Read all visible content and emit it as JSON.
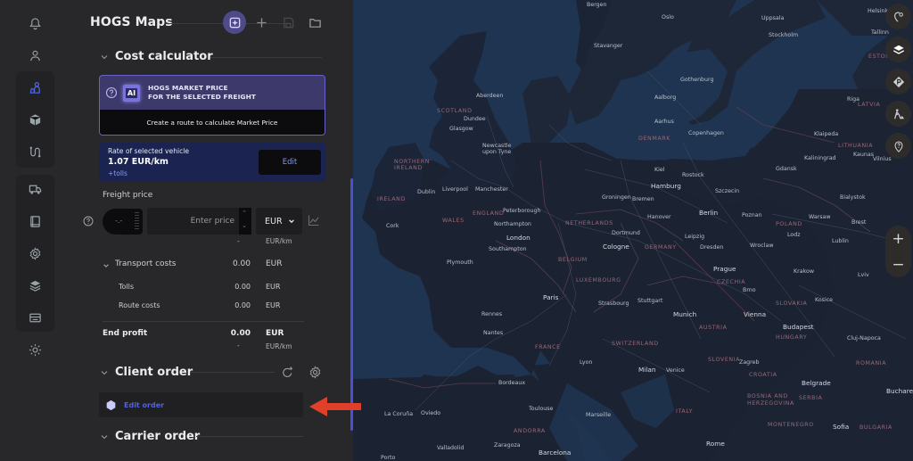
{
  "app": {
    "title": "HOGS Maps"
  },
  "rail": {
    "items": [
      {
        "name": "notifications",
        "icon": "bell-icon"
      },
      {
        "name": "profile",
        "icon": "user-icon"
      },
      {
        "name": "freight",
        "icon": "people-icon",
        "active": true
      },
      {
        "name": "cargo",
        "icon": "box-icon"
      },
      {
        "name": "routes",
        "icon": "route-icon"
      },
      {
        "name": "vehicles",
        "icon": "truck-icon"
      },
      {
        "name": "documents",
        "icon": "book-icon"
      },
      {
        "name": "settings",
        "icon": "gear-icon"
      },
      {
        "name": "layers",
        "icon": "stack-icon"
      },
      {
        "name": "billing",
        "icon": "card-icon"
      },
      {
        "name": "theme",
        "icon": "sun-icon"
      }
    ]
  },
  "header_buttons": [
    {
      "name": "ai-assistant",
      "icon": "sparkle-doc-icon",
      "active": true
    },
    {
      "name": "add",
      "icon": "plus-icon"
    },
    {
      "name": "save",
      "icon": "save-icon",
      "disabled": true
    },
    {
      "name": "open",
      "icon": "folder-icon"
    }
  ],
  "cost_calculator": {
    "title": "Cost calculator",
    "market": {
      "badge": "AI",
      "title_line1": "HOGS MARKET PRICE",
      "title_line2": "FOR THE SELECTED FREIGHT",
      "cta": "Create a route to calculate Market Price"
    },
    "rate": {
      "label": "Rate of selected vehicle",
      "value": "1.07 EUR/km",
      "tolls": "+tolls",
      "edit_label": "Edit"
    },
    "freight_price": {
      "label": "Freight price",
      "toggle_value": "-.-",
      "input_value": "",
      "input_placeholder": "Enter price",
      "stepper_up": "^",
      "stepper_down": "v",
      "currency": "EUR",
      "per_km_value": "-",
      "per_km_unit": "EUR/km"
    },
    "transport_costs": {
      "label": "Transport costs",
      "value": "0.00",
      "currency": "EUR",
      "items": [
        {
          "label": "Tolls",
          "value": "0.00",
          "currency": "EUR"
        },
        {
          "label": "Route costs",
          "value": "0.00",
          "currency": "EUR"
        }
      ]
    },
    "end_profit": {
      "label": "End profit",
      "value": "0.00",
      "currency": "EUR",
      "per_km_value": "-",
      "per_km_unit": "EUR/km"
    }
  },
  "client_order": {
    "title": "Client order",
    "edit_label": "Edit order"
  },
  "carrier_order": {
    "title": "Carrier order"
  },
  "annotation": {
    "arrow_color": "#e0402a"
  },
  "colors": {
    "accent": "#5162e0",
    "panel_bg": "#28282a",
    "map_water": "#1f3450",
    "scrollbar": "#4c4fd2"
  },
  "map": {
    "controls": [
      {
        "name": "location-settings",
        "icon": "pin-gear-icon"
      },
      {
        "name": "layers",
        "icon": "layers-icon"
      },
      {
        "name": "parking",
        "icon": "parking-icon"
      },
      {
        "name": "roadworks",
        "icon": "roadworks-icon"
      },
      {
        "name": "poi-help",
        "icon": "pin-question-icon"
      }
    ],
    "zoom_in": "+",
    "zoom_out": "−",
    "countries": [
      "SCOTLAND",
      "NORTHERN IRELAND",
      "IRELAND",
      "WALES",
      "ENGLAND",
      "NETHERLANDS",
      "BELGIUM",
      "LUXEMBOURG",
      "FRANCE",
      "ANDORRA",
      "GERMANY",
      "DENMARK",
      "CZECHIA",
      "SLOVAKIA",
      "AUSTRIA",
      "HUNGARY",
      "SLOVENIA",
      "CROATIA",
      "BOSNIA AND HERZEGOVINA",
      "SERBIA",
      "MONTENEGRO",
      "ROMANIA",
      "BULGARIA",
      "ITALY",
      "POLAND",
      "LITHUANIA",
      "LATVIA",
      "ESTONIA",
      "SWITZERLAND"
    ],
    "cities": [
      "Bergen",
      "Stavanger",
      "Oslo",
      "Uppsala",
      "Stockholm",
      "Helsinki",
      "Tallinn",
      "Gothenburg",
      "Aalborg",
      "Aarhus",
      "Copenhagen",
      "Riga",
      "Kaunas",
      "Vilnius",
      "Klaipeda",
      "Kaliningrad",
      "Gdansk",
      "Szczecin",
      "Rostock",
      "Kiel",
      "Hamburg",
      "Bremen",
      "Groningen",
      "Hanover",
      "Berlin",
      "Poznan",
      "Warsaw",
      "Bialystok",
      "Brest",
      "Aberdeen",
      "Dundee",
      "Glasgow",
      "Newcastle upon Tyne",
      "Dublin",
      "Liverpool",
      "Manchester",
      "Peterborough",
      "Northampton",
      "London",
      "Southampton",
      "Plymouth",
      "Cork",
      "Cologne",
      "Dortmund",
      "Leipzig",
      "Dresden",
      "Wroclaw",
      "Lodz",
      "Lublin",
      "Prague",
      "Brno",
      "Krakow",
      "Paris",
      "Rennes",
      "Nantes",
      "Bordeaux",
      "Toulouse",
      "Lyon",
      "Marseille",
      "Strasbourg",
      "Munich",
      "Stuttgart",
      "Vienna",
      "Budapest",
      "Milan",
      "Venice",
      "Zagreb",
      "Belgrade",
      "Bucharest",
      "Sofia",
      "Rome",
      "Barcelona",
      "Zaragoza",
      "Valladolid",
      "Porto",
      "La Coruña",
      "Oviedo",
      "Kosice",
      "Cluj-Napoca",
      "Lviv"
    ]
  }
}
